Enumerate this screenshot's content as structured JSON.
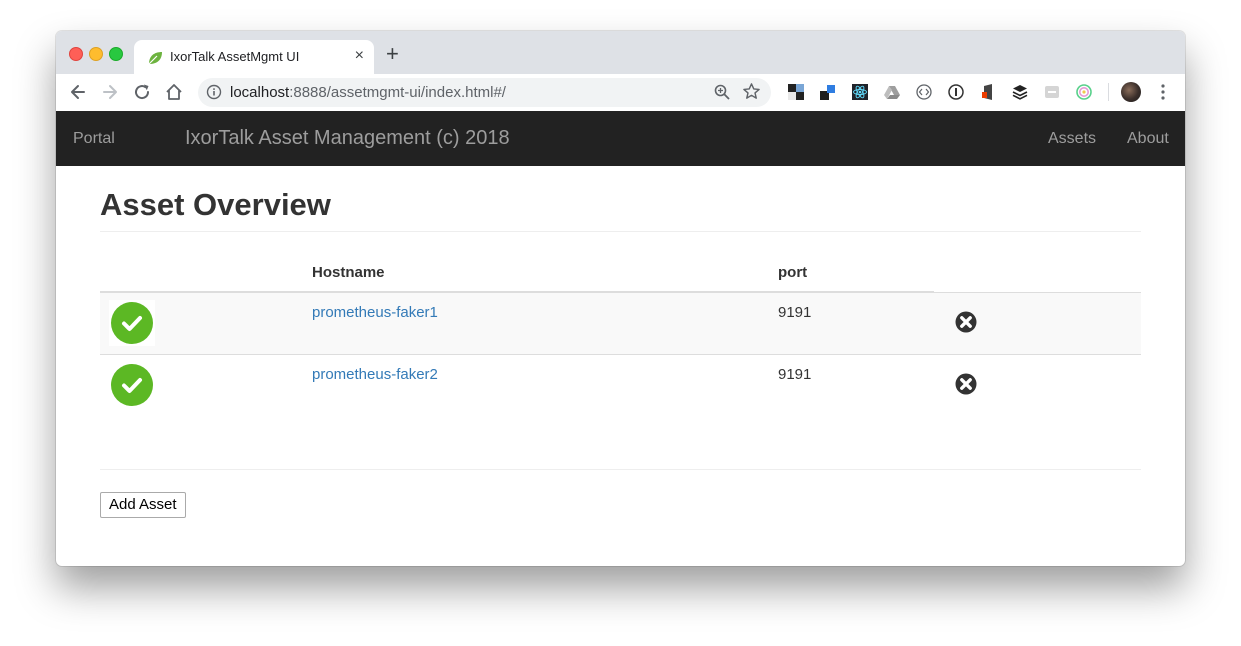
{
  "browser": {
    "tab": {
      "title": "IxorTalk AssetMgmt UI",
      "close_glyph": "×"
    },
    "new_tab_glyph": "+",
    "address": {
      "host": "localhost",
      "path": ":8888/assetmgmt-ui/index.html#/"
    }
  },
  "navbar": {
    "portal_label": "Portal",
    "brand": "IxorTalk Asset Management (c) 2018",
    "assets_label": "Assets",
    "about_label": "About"
  },
  "page": {
    "title": "Asset Overview",
    "columns": {
      "hostname": "Hostname",
      "port": "port"
    },
    "assets": [
      {
        "status": "up",
        "hostname": "prometheus-faker1",
        "port": "9191"
      },
      {
        "status": "up",
        "hostname": "prometheus-faker2",
        "port": "9191"
      }
    ],
    "add_button": "Add Asset"
  },
  "colors": {
    "navbar_bg": "#222222",
    "navbar_text": "#9d9d9d",
    "link": "#337ab7",
    "status_ok": "#5cb824"
  }
}
